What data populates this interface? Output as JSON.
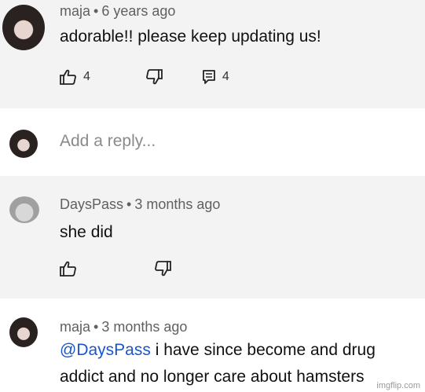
{
  "comments": [
    {
      "author": "maja",
      "time": "6 years ago",
      "text": "adorable!! please keep updating us!",
      "likes": "4",
      "replies": "4"
    },
    {
      "author": "DaysPass",
      "time": "3 months ago",
      "text": "she did"
    },
    {
      "author": "maja",
      "time": "3 months ago",
      "mention": "@DaysPass",
      "line1": "i have since become and drug",
      "line2": "addict and no longer care about hamsters"
    }
  ],
  "reply_box": {
    "placeholder": "Add a reply..."
  },
  "separator": "•",
  "watermark": "imgflip.com"
}
